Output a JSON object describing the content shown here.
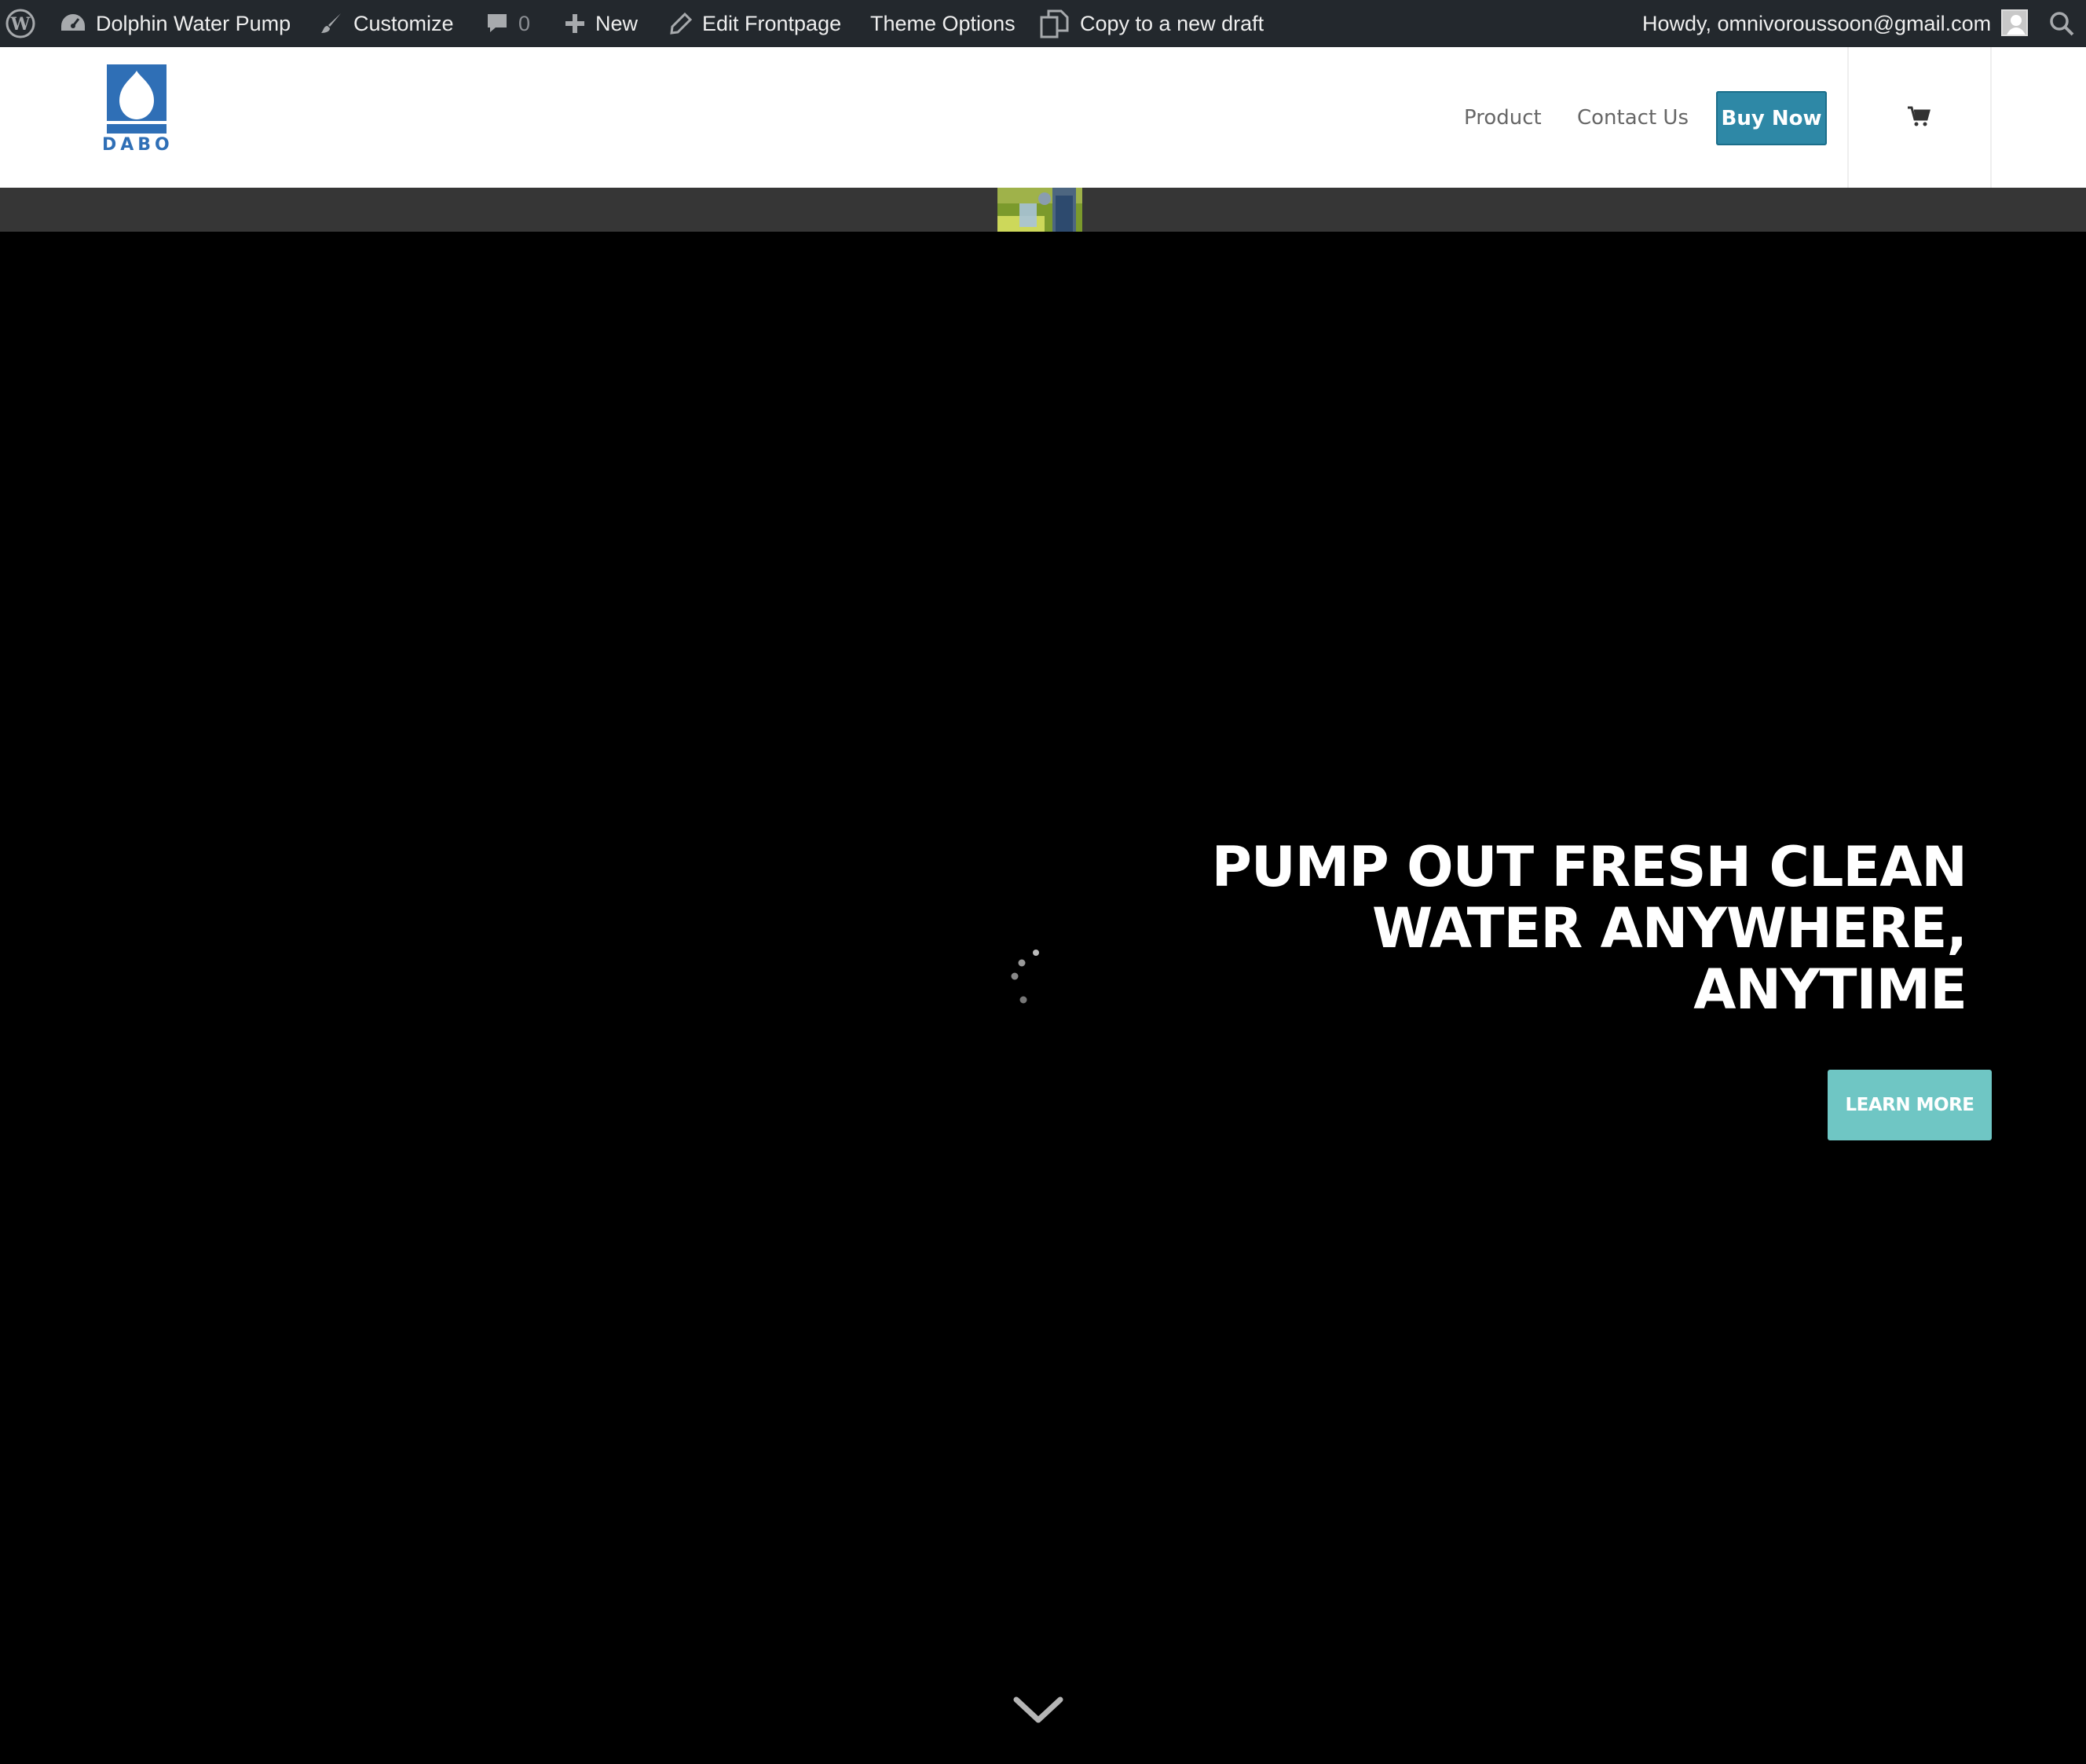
{
  "adminbar": {
    "site_name": "Dolphin Water Pump",
    "customize": "Customize",
    "comments_count": "0",
    "new": "New",
    "edit_frontpage": "Edit Frontpage",
    "theme_options": "Theme Options",
    "copy_draft": "Copy to a new draft",
    "howdy": "Howdy, omnivoroussoon@gmail.com"
  },
  "header": {
    "logo_text": "DABO",
    "nav": {
      "product": "Product",
      "contact": "Contact Us",
      "buy_now": "Buy Now"
    }
  },
  "hero": {
    "title_lines": [
      "PUMP OUT FRESH CLEAN",
      "WATER ANYWHERE,",
      "ANYTIME"
    ],
    "cta": "LEARN MORE"
  },
  "colors": {
    "adminbar_bg": "#23282d",
    "brand_blue": "#2f6fb6",
    "buy_button": "#2e88a6",
    "cta_teal": "#6fc6c4",
    "strip": "#363636"
  },
  "icons": [
    "wordpress-icon",
    "dashboard-icon",
    "brush-icon",
    "comment-icon",
    "plus-icon",
    "pencil-icon",
    "copy-icon",
    "avatar",
    "search-icon",
    "cart-icon",
    "loading-spinner",
    "chevron-down-icon"
  ]
}
